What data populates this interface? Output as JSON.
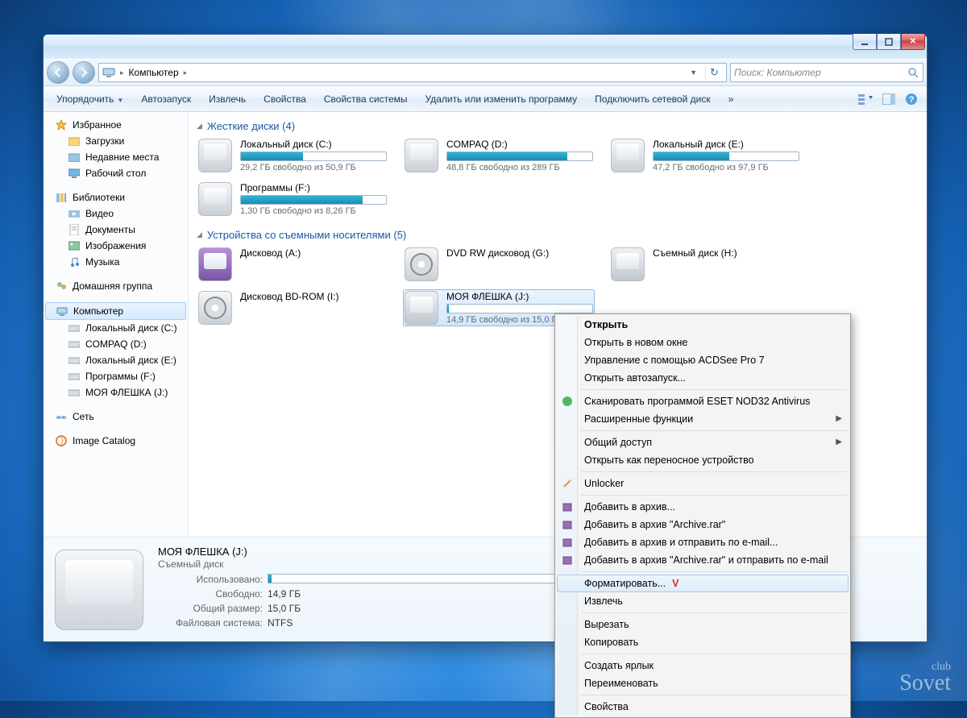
{
  "breadcrumb": "Компьютер",
  "search_placeholder": "Поиск: Компьютер",
  "toolbar": {
    "organize": "Упорядочить",
    "autoplay": "Автозапуск",
    "eject": "Извлечь",
    "props": "Свойства",
    "sysprops": "Свойства системы",
    "uninstall": "Удалить или изменить программу",
    "mapdrive": "Подключить сетевой диск",
    "overflow": "»"
  },
  "sidebar": {
    "fav_h": "Избранное",
    "fav": [
      "Загрузки",
      "Недавние места",
      "Рабочий стол"
    ],
    "lib_h": "Библиотеки",
    "lib": [
      "Видео",
      "Документы",
      "Изображения",
      "Музыка"
    ],
    "homegroup": "Домашняя группа",
    "computer": "Компьютер",
    "drives": [
      "Локальный диск (C:)",
      "COMPAQ (D:)",
      "Локальный диск (E:)",
      "Программы  (F:)",
      "МОЯ ФЛЕШКА (J:)"
    ],
    "network": "Сеть",
    "catalog": "Image Catalog"
  },
  "sections": {
    "hdd": "Жесткие диски (4)",
    "removable": "Устройства со съемными носителями (5)"
  },
  "hdd": [
    {
      "name": "Локальный диск (C:)",
      "free": "29,2 ГБ свободно из 50,9 ГБ",
      "pct": 43
    },
    {
      "name": "COMPAQ (D:)",
      "free": "48,8 ГБ свободно из 289 ГБ",
      "pct": 83
    },
    {
      "name": "Локальный диск (E:)",
      "free": "47,2 ГБ свободно из 97,9 ГБ",
      "pct": 52
    },
    {
      "name": "Программы  (F:)",
      "free": "1,30 ГБ свободно из 8,26 ГБ",
      "pct": 84
    }
  ],
  "removable": [
    {
      "name": "Дисковод (A:)",
      "kind": "floppy"
    },
    {
      "name": "DVD RW дисковод (G:)",
      "kind": "dvd"
    },
    {
      "name": "Съемный диск (H:)",
      "kind": "usb"
    },
    {
      "name": "Дисковод BD-ROM (I:)",
      "kind": "dvd"
    },
    {
      "name": "МОЯ ФЛЕШКА (J:)",
      "free": "14,9 ГБ свободно из 15,0 ГБ",
      "pct": 1,
      "sel": true,
      "kind": "usb"
    }
  ],
  "details": {
    "title": "МОЯ ФЛЕШКА (J:)",
    "subtitle": "Съемный диск",
    "used_lbl": "Использовано:",
    "used_pct": 1,
    "free_lbl": "Свободно:",
    "free": "14,9 ГБ",
    "size_lbl": "Общий размер:",
    "size": "15,0 ГБ",
    "fs_lbl": "Файловая система:",
    "fs": "NTFS"
  },
  "ctx": {
    "open": "Открыть",
    "open_new": "Открыть в новом окне",
    "acdsee": "Управление с помощью ACDSee Pro 7",
    "autoplay": "Открыть автозапуск...",
    "nod32": "Сканировать программой ESET NOD32 Antivirus",
    "adv": "Расширенные функции",
    "share": "Общий доступ",
    "portable": "Открыть как переносное устройство",
    "unlocker": "Unlocker",
    "ar1": "Добавить в архив...",
    "ar2": "Добавить в архив \"Archive.rar\"",
    "ar3": "Добавить в архив и отправить по e-mail...",
    "ar4": "Добавить в архив \"Archive.rar\" и отправить по e-mail",
    "format": "Форматировать...",
    "eject": "Извлечь",
    "cut": "Вырезать",
    "copy": "Копировать",
    "shortcut": "Создать ярлык",
    "rename": "Переименовать",
    "props": "Свойства"
  },
  "watermark": {
    "top": "club",
    "bottom": "Sovet"
  }
}
